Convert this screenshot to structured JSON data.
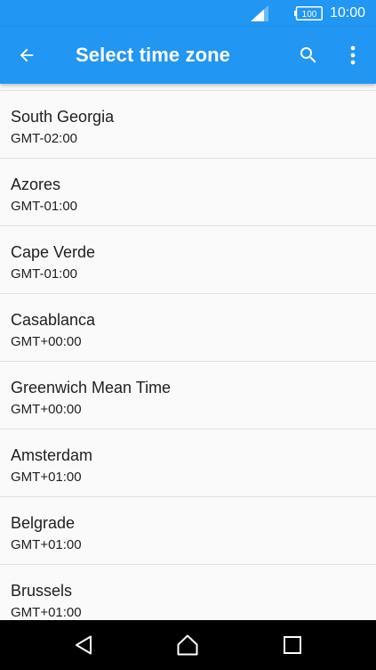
{
  "status_bar": {
    "battery_level": "100",
    "time": "10:00",
    "signal_icon": "signal-icon",
    "battery_icon": "battery-icon"
  },
  "app_bar": {
    "title": "Select time zone",
    "back_icon": "arrow-back-icon",
    "search_icon": "search-icon",
    "more_icon": "more-vert-icon"
  },
  "time_zones": [
    {
      "name": "South Georgia",
      "offset": "GMT-02:00"
    },
    {
      "name": "Azores",
      "offset": "GMT-01:00"
    },
    {
      "name": "Cape Verde",
      "offset": "GMT-01:00"
    },
    {
      "name": "Casablanca",
      "offset": "GMT+00:00"
    },
    {
      "name": "Greenwich Mean Time",
      "offset": "GMT+00:00"
    },
    {
      "name": "Amsterdam",
      "offset": "GMT+01:00"
    },
    {
      "name": "Belgrade",
      "offset": "GMT+01:00"
    },
    {
      "name": "Brussels",
      "offset": "GMT+01:00"
    }
  ],
  "colors": {
    "primary": "#2196f3",
    "background": "#fafafa",
    "divider": "#e0e0e0",
    "text": "#212121",
    "nav_bar": "#000000"
  }
}
